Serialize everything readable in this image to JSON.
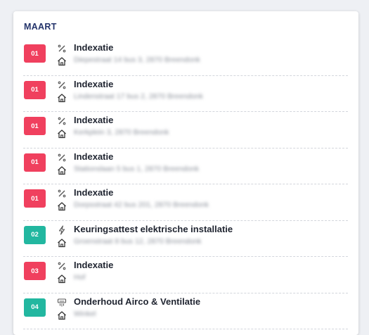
{
  "month": "MAART",
  "colors": {
    "red": "#f0405e",
    "teal": "#22b7a0"
  },
  "items": [
    {
      "day": "01",
      "color": "#f0405e",
      "icon": "percent-icon",
      "title": "Indexatie",
      "address": "Diepestraat 14 bus 3, 2870 Breendonk"
    },
    {
      "day": "01",
      "color": "#f0405e",
      "icon": "percent-icon",
      "title": "Indexatie",
      "address": "Lindenstraat 17 bus 2, 2870 Breendonk"
    },
    {
      "day": "01",
      "color": "#f0405e",
      "icon": "percent-icon",
      "title": "Indexatie",
      "address": "Kerkplein 3, 2870 Breendonk"
    },
    {
      "day": "01",
      "color": "#f0405e",
      "icon": "percent-icon",
      "title": "Indexatie",
      "address": "Stationslaan 5 bus 1, 2870 Breendonk"
    },
    {
      "day": "01",
      "color": "#f0405e",
      "icon": "percent-icon",
      "title": "Indexatie",
      "address": "Dorpsstraat 42 bus 201, 2870 Breendonk"
    },
    {
      "day": "02",
      "color": "#22b7a0",
      "icon": "lightning-icon",
      "title": "Keuringsattest elektrische installatie",
      "address": "Groenstraat 8 bus 12, 2870 Breendonk"
    },
    {
      "day": "03",
      "color": "#f0405e",
      "icon": "percent-icon",
      "title": "Indexatie",
      "address": "Hof"
    },
    {
      "day": "04",
      "color": "#22b7a0",
      "icon": "aircon-icon",
      "title": "Onderhoud Airco & Ventilatie",
      "address": "Winkel"
    }
  ]
}
